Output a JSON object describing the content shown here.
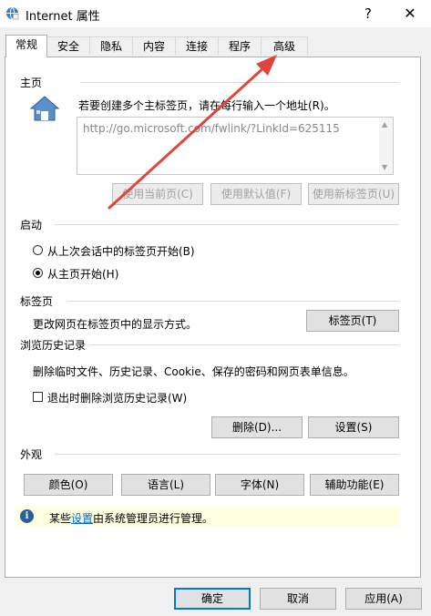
{
  "window": {
    "title": "Internet 属性",
    "help_label": "?",
    "close_label": "✕",
    "icon": "internet-options-icon"
  },
  "tabs": [
    {
      "label": "常规",
      "active": true
    },
    {
      "label": "安全",
      "active": false
    },
    {
      "label": "隐私",
      "active": false
    },
    {
      "label": "内容",
      "active": false
    },
    {
      "label": "连接",
      "active": false
    },
    {
      "label": "程序",
      "active": false
    },
    {
      "label": "高级",
      "active": false
    }
  ],
  "home": {
    "title": "主页",
    "description": "若要创建多个主标签页，请在每行输入一个地址(R)。",
    "url": "http://go.microsoft.com/fwlink/?LinkId=625115",
    "use_current": "使用当前页(C)",
    "use_default": "使用默认值(F)",
    "use_new_tab": "使用新标签页(U)"
  },
  "startup": {
    "title": "启动",
    "option_last_session": "从上次会话中的标签页开始(B)",
    "option_home": "从主页开始(H)",
    "selected": "home"
  },
  "tabs_section": {
    "title": "标签页",
    "description": "更改网页在标签页中的显示方式。",
    "button": "标签页(T)"
  },
  "history": {
    "title": "浏览历史记录",
    "description": "删除临时文件、历史记录、Cookie、保存的密码和网页表单信息。",
    "delete_on_exit": "退出时删除浏览历史记录(W)",
    "delete_on_exit_checked": false,
    "delete_button": "删除(D)...",
    "settings_button": "设置(S)"
  },
  "appearance": {
    "title": "外观",
    "colors": "颜色(O)",
    "languages": "语言(L)",
    "fonts": "字体(N)",
    "accessibility": "辅助功能(E)"
  },
  "info": {
    "prefix": "某些",
    "link": "设置",
    "suffix": "由系统管理员进行管理。"
  },
  "footer": {
    "ok": "确定",
    "cancel": "取消",
    "apply": "应用(A)"
  },
  "colors": {
    "arrow": "#e0453c",
    "info_background": "#ffffe1",
    "default_button_border": "#0078d7"
  }
}
